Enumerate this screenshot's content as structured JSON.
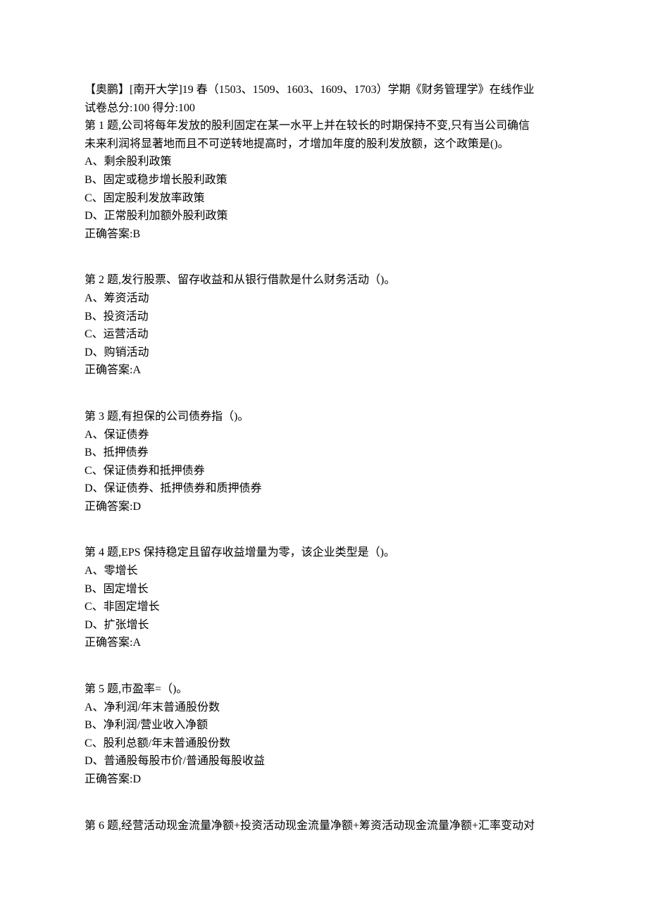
{
  "header": {
    "title_line": "【奥鹏】[南开大学]19 春（1503、1509、1603、1609、1703）学期《财务管理学》在线作业",
    "score_line": "试卷总分:100     得分:100"
  },
  "questions": [
    {
      "prompt_line1": "第 1 题,公司将每年发放的股利固定在某一水平上并在较长的时期保持不变,只有当公司确信",
      "prompt_line2": "未来利润将显著地而且不可逆转地提高时，才增加年度的股利发放额，这个政策是()。",
      "options": [
        "A、剩余股利政策",
        "B、固定或稳步增长股利政策",
        "C、固定股利发放率政策",
        "D、正常股利加额外股利政策"
      ],
      "answer": "正确答案:B"
    },
    {
      "prompt_line1": "第 2 题,发行股票、留存收益和从银行借款是什么财务活动（)。",
      "options": [
        "A、筹资活动",
        "B、投资活动",
        "C、运营活动",
        "D、购销活动"
      ],
      "answer": "正确答案:A"
    },
    {
      "prompt_line1": "第 3 题,有担保的公司债券指（)。",
      "options": [
        "A、保证债券",
        "B、抵押债券",
        "C、保证债券和抵押债券",
        "D、保证债券、抵押债券和质押债券"
      ],
      "answer": "正确答案:D"
    },
    {
      "prompt_line1": "第 4 题,EPS 保持稳定且留存收益增量为零，该企业类型是（)。",
      "options": [
        "A、零增长",
        "B、固定增长",
        "C、非固定增长",
        "D、扩张增长"
      ],
      "answer": "正确答案:A"
    },
    {
      "prompt_line1": "第 5 题,市盈率=（)。",
      "options": [
        "A、净利润/年末普通股份数",
        "B、净利润/营业收入净额",
        "C、股利总额/年末普通股份数",
        "D、普通股每股市价/普通股每股收益"
      ],
      "answer": "正确答案:D"
    },
    {
      "prompt_line1": "第 6 题,经营活动现金流量净额+投资活动现金流量净额+筹资活动现金流量净额+汇率变动对"
    }
  ]
}
